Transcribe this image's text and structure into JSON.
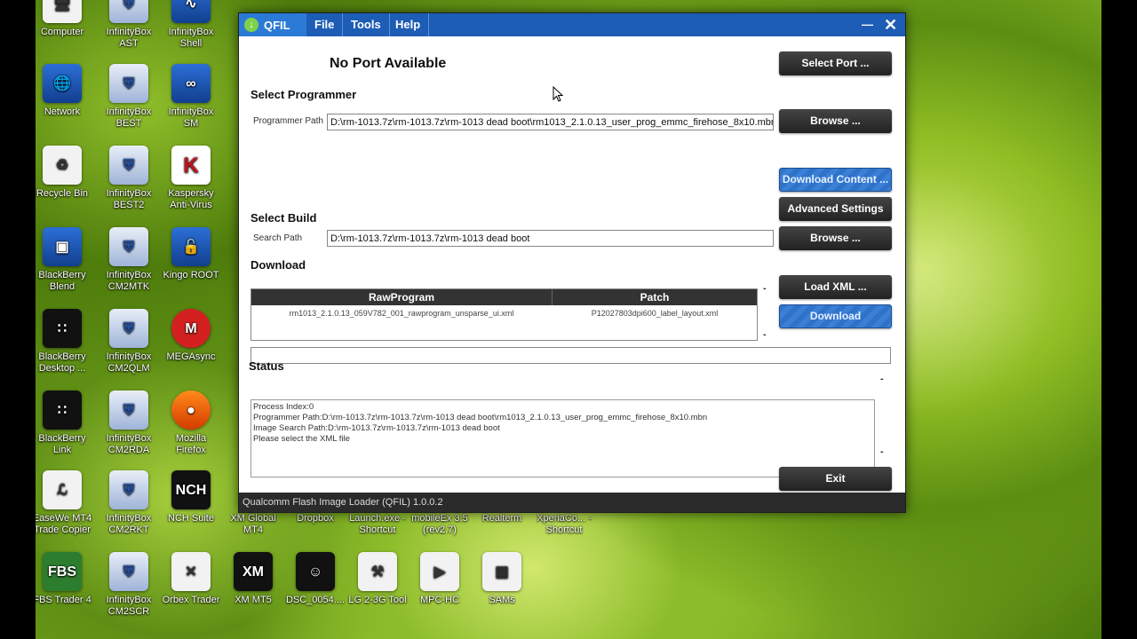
{
  "desktop": {
    "icons": [
      {
        "label": "Computer",
        "glyph": "🖥",
        "style": "white"
      },
      {
        "label": "InfinityBox AST",
        "glyph": "⛨",
        "style": "shield"
      },
      {
        "label": "InfinityBox Shell",
        "glyph": "∿",
        "style": "blue"
      },
      {
        "label": "Network",
        "glyph": "🌐",
        "style": "blue"
      },
      {
        "label": "InfinityBox BEST",
        "glyph": "⛨",
        "style": "shield"
      },
      {
        "label": "InfinityBox SM",
        "glyph": "∞",
        "style": "blue"
      },
      {
        "label": "Recycle Bin",
        "glyph": "♻",
        "style": "white"
      },
      {
        "label": "InfinityBox BEST2",
        "glyph": "⛨",
        "style": "shield"
      },
      {
        "label": "Kaspersky Anti-Virus",
        "glyph": "K",
        "style": "kasp"
      },
      {
        "label": "BlackBerry Blend",
        "glyph": "▣",
        "style": "blue"
      },
      {
        "label": "InfinityBox CM2MTK",
        "glyph": "⛨",
        "style": "shield"
      },
      {
        "label": "Kingo ROOT",
        "glyph": "🔓",
        "style": "blue"
      },
      {
        "label": "BlackBerry Desktop ...",
        "glyph": "∷",
        "style": "dark"
      },
      {
        "label": "InfinityBox CM2QLM",
        "glyph": "⛨",
        "style": "shield"
      },
      {
        "label": "MEGAsync",
        "glyph": "M",
        "style": "red"
      },
      {
        "label": "BlackBerry Link",
        "glyph": "∷",
        "style": "dark"
      },
      {
        "label": "InfinityBox CM2RDA",
        "glyph": "⛨",
        "style": "shield"
      },
      {
        "label": "Mozilla Firefox",
        "glyph": "●",
        "style": "orange"
      },
      {
        "label": "EaseWe MT4 Trade Copier",
        "glyph": "ℒ",
        "style": "white"
      },
      {
        "label": "InfinityBox CM2RKT",
        "glyph": "⛨",
        "style": "shield"
      },
      {
        "label": "NCH Suite",
        "glyph": "NCH",
        "style": "dark"
      },
      {
        "label": "XM Global MT4",
        "glyph": "",
        "style": "none"
      },
      {
        "label": "Dropbox",
        "glyph": "",
        "style": "none"
      },
      {
        "label": "Launch.exe - Shortcut",
        "glyph": "",
        "style": "none"
      },
      {
        "label": "mobileEx 3.5 (rev2.7)",
        "glyph": "",
        "style": "none"
      },
      {
        "label": "Realterm",
        "glyph": "",
        "style": "none"
      },
      {
        "label": "XperiaCo... - Shortcut",
        "glyph": "",
        "style": "none"
      },
      {
        "label": "FBS Trader 4",
        "glyph": "FBS",
        "style": "green"
      },
      {
        "label": "InfinityBox CM2SCR",
        "glyph": "⛨",
        "style": "shield"
      },
      {
        "label": "Orbex Trader",
        "glyph": "✕",
        "style": "white"
      },
      {
        "label": "XM MT5",
        "glyph": "XM",
        "style": "dark"
      },
      {
        "label": "DSC_0054....",
        "glyph": "☺",
        "style": "dark"
      },
      {
        "label": "LG 2-3G Tool",
        "glyph": "⚒",
        "style": "white"
      },
      {
        "label": "MPC-HC",
        "glyph": "▶",
        "style": "white"
      },
      {
        "label": "SAMs",
        "glyph": "▦",
        "style": "white"
      }
    ]
  },
  "qfil": {
    "app_logo": "QFIL",
    "menus": [
      "File",
      "Tools",
      "Help"
    ],
    "minimize_glyph": "—",
    "close_glyph": "✕",
    "port_status": "No Port Available",
    "select_port_button": "Select Port ...",
    "select_programmer_heading": "Select Programmer",
    "programmer_path_label": "Programmer Path",
    "programmer_path_value": "D:\\rm-1013.7z\\rm-1013.7z\\rm-1013 dead boot\\rm1013_2.1.0.13_user_prog_emmc_firehose_8x10.mbn",
    "browse_button_1": "Browse ...",
    "download_content_button": "Download Content ...",
    "advanced_settings_button": "Advanced Settings",
    "select_build_heading": "Select Build",
    "search_path_label": "Search Path",
    "search_path_value": "D:\\rm-1013.7z\\rm-1013.7z\\rm-1013 dead boot",
    "browse_button_2": "Browse ...",
    "download_heading": "Download",
    "table": {
      "columns": [
        "RawProgram",
        "Patch"
      ],
      "rows": [
        [
          "rm1013_2.1.0.13_059V782_001_rawprogram_unsparse_ui.xml",
          "P12027803dpi600_label_layout.xml"
        ]
      ]
    },
    "load_xml_button": "Load XML ...",
    "download_button": "Download",
    "status_heading": "Status",
    "status_lines": [
      "Process Index:0",
      "Programmer Path:D:\\rm-1013.7z\\rm-1013.7z\\rm-1013 dead boot\\rm1013_2.1.0.13_user_prog_emmc_firehose_8x10.mbn",
      "Image Search Path:D:\\rm-1013.7z\\rm-1013.7z\\rm-1013 dead boot",
      "Please select the XML file"
    ],
    "exit_button": "Exit",
    "footer": "Qualcomm Flash Image Loader (QFIL)   1.0.0.2",
    "dash_glyph": "-"
  }
}
